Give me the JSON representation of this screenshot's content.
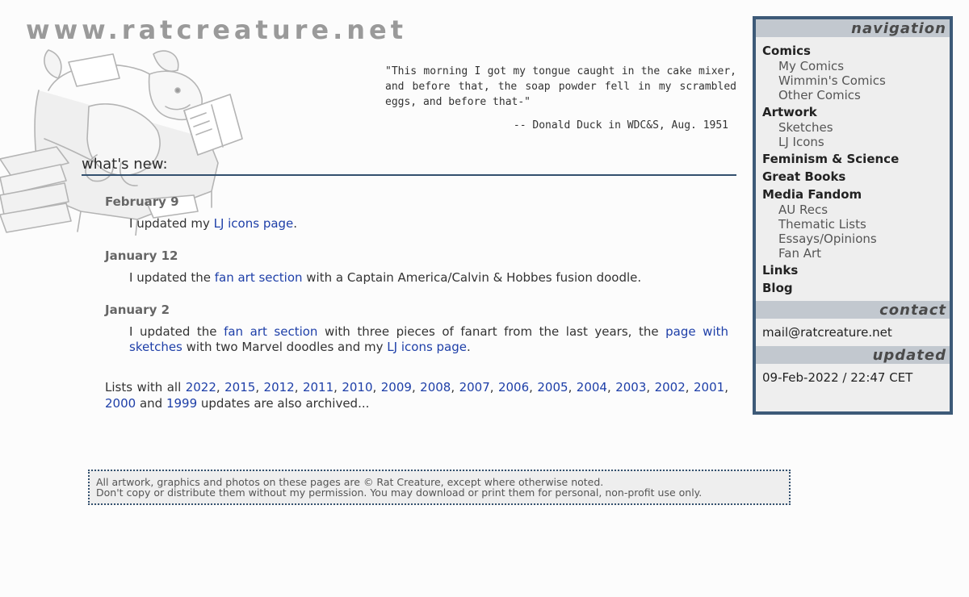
{
  "header": {
    "site_title": "www.ratcreature.net",
    "quote": "\"This morning I got my tongue caught in the cake mixer, and before that, the soap powder fell in my scrambled eggs, and before that-\"",
    "quote_attribution": "-- Donald Duck in WDC&S, Aug. 1951"
  },
  "main": {
    "heading": "what's new:",
    "entries": [
      {
        "date": "February 9",
        "text_before": "I updated my ",
        "link1": "LJ icons page",
        "text_after": "."
      },
      {
        "date": "January 12",
        "text_before": "I updated the ",
        "link1": "fan art section",
        "text_after": " with a Captain America/Calvin & Hobbes fusion doodle."
      },
      {
        "date": "January 2",
        "text_before": "I updated the ",
        "link1": "fan art section",
        "text_mid": " with three pieces of fanart from the last years, the ",
        "link2": "page with sketches",
        "text_mid2": " with two Marvel doodles and my ",
        "link3": "LJ icons page",
        "text_after": "."
      }
    ],
    "archive": {
      "prefix": "Lists with all ",
      "years": [
        "2022",
        "2015",
        "2012",
        "2011",
        "2010",
        "2009",
        "2008",
        "2007",
        "2006",
        "2005",
        "2004",
        "2003",
        "2002",
        "2001",
        "2000"
      ],
      "and": " and ",
      "last_year": "1999",
      "suffix": " updates are also archived..."
    }
  },
  "footer": {
    "line1": "All artwork, graphics and photos on these pages are © Rat Creature, except where otherwise noted.",
    "line2": "Don't copy or distribute them without my permission. You may download or print them for personal, non-profit use only."
  },
  "sidebar": {
    "nav_header": "navigation",
    "comics": "Comics",
    "comics_sub": [
      "My Comics",
      "Wimmin's Comics",
      "Other Comics"
    ],
    "artwork": "Artwork",
    "artwork_sub": [
      "Sketches",
      "LJ Icons"
    ],
    "feminism": "Feminism & Science",
    "books": "Great Books",
    "fandom": "Media Fandom",
    "fandom_sub": [
      "AU Recs",
      "Thematic Lists",
      "Essays/Opinions",
      "Fan Art"
    ],
    "links": "Links",
    "blog": "Blog",
    "contact_header": "contact",
    "email": "mail@ratcreature.net",
    "updated_header": "updated",
    "updated_value": "09-Feb-2022 / 22:47 CET"
  }
}
